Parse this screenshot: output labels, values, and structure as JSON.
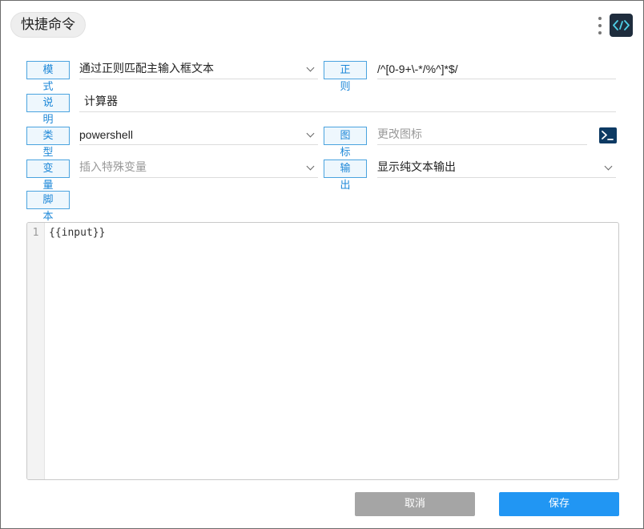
{
  "window": {
    "title": "快捷命令"
  },
  "header": {
    "more_icon": "more-vertical-icon",
    "logo_icon": "code-brackets-icon"
  },
  "form": {
    "mode_label": "模式",
    "mode_value": "通过正则匹配主输入框文本",
    "regex_label": "正则",
    "regex_value": "/^[0-9+\\-*/%^]*$/",
    "desc_label": "说明",
    "desc_value": "计算器",
    "type_label": "类型",
    "type_value": "powershell",
    "icon_label": "图标",
    "icon_placeholder": "更改图标",
    "icon_preview": "powershell-terminal-icon",
    "var_label": "变量",
    "var_placeholder": "插入特殊变量",
    "output_label": "输出",
    "output_value": "显示纯文本输出",
    "script_label": "脚本"
  },
  "editor": {
    "line_numbers": [
      "1"
    ],
    "lines": [
      "{{input}}"
    ]
  },
  "actions": {
    "cancel_label": "取消",
    "save_label": "保存"
  },
  "colors": {
    "accent": "#2196f3",
    "tag_border": "#4aa3df",
    "cancel": "#a5a5a5",
    "logo_bg": "#1f2d3d",
    "terminal_bg": "#0d3a63"
  }
}
